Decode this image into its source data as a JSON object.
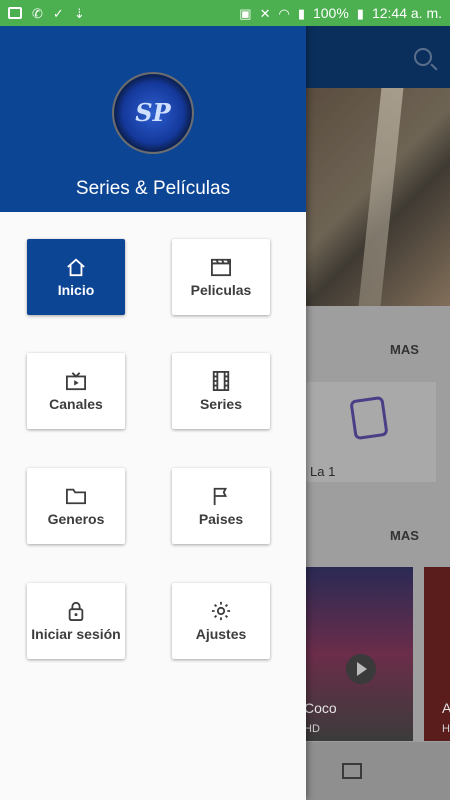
{
  "status_bar": {
    "battery": "100%",
    "time": "12:44 a. m."
  },
  "drawer": {
    "title": "Series & Películas",
    "logo_text": "SP",
    "items": [
      {
        "label": "Inicio",
        "icon": "home-icon",
        "active": true
      },
      {
        "label": "Peliculas",
        "icon": "clapperboard-icon",
        "active": false
      },
      {
        "label": "Canales",
        "icon": "tv-icon",
        "active": false
      },
      {
        "label": "Series",
        "icon": "film-strip-icon",
        "active": false
      },
      {
        "label": "Generos",
        "icon": "folder-icon",
        "active": false
      },
      {
        "label": "Paises",
        "icon": "flag-icon",
        "active": false
      },
      {
        "label": "Iniciar sesión",
        "icon": "lock-icon",
        "active": false
      },
      {
        "label": "Ajustes",
        "icon": "gear-icon",
        "active": false
      }
    ]
  },
  "background": {
    "more_label_1": "MAS",
    "channel_label": "La 1",
    "more_label_2": "MAS",
    "poster_title": "Coco",
    "poster_quality": "HD",
    "poster2_title": "A",
    "poster2_quality": "H"
  },
  "colors": {
    "header": "#0d4595",
    "status_bar": "#4caf50",
    "active_tile": "#0d4595"
  }
}
